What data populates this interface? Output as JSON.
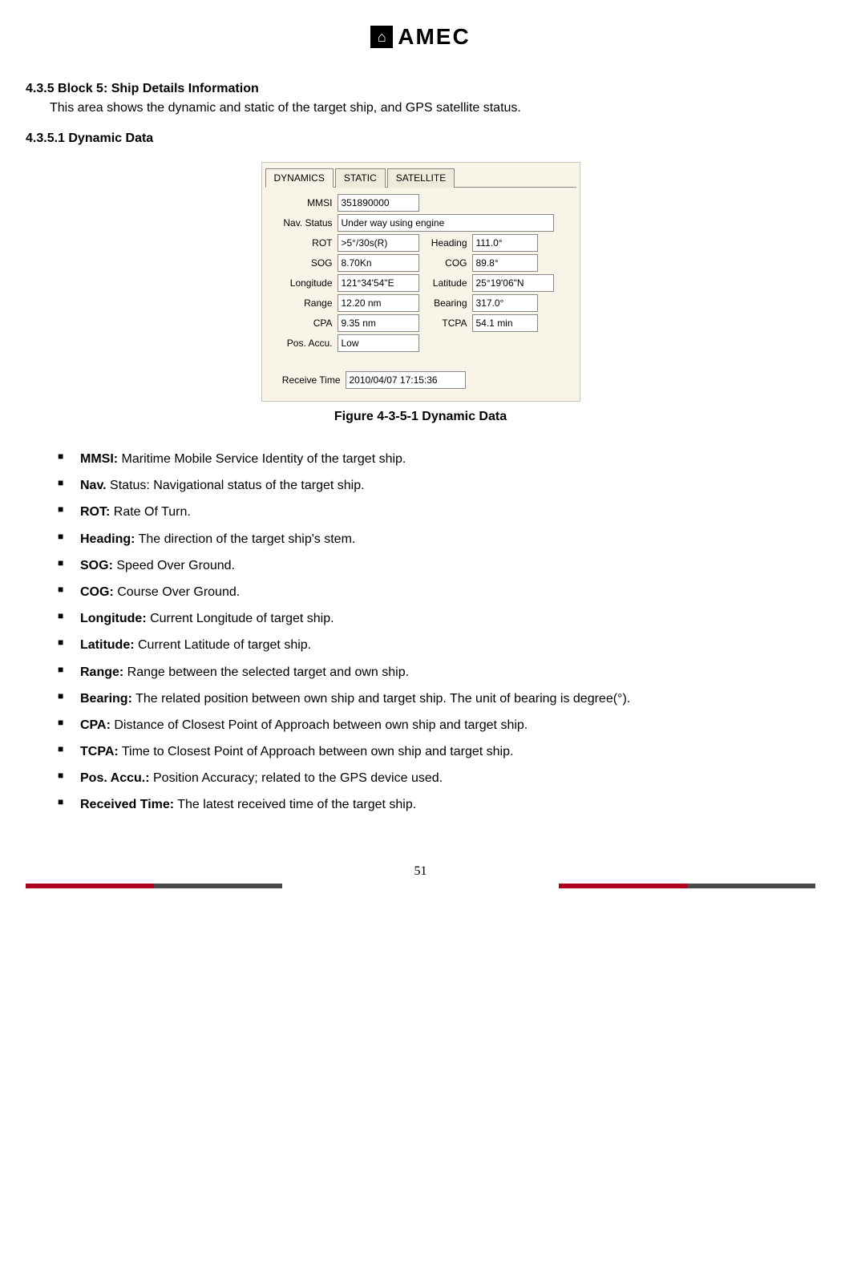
{
  "logo": {
    "text": "AMEC"
  },
  "section": {
    "h1": "4.3.5 Block 5: Ship Details Information",
    "intro": "This area shows the dynamic and static of the target ship, and GPS satellite status.",
    "h2": "4.3.5.1 Dynamic Data",
    "caption": "Figure 4-3-5-1 Dynamic Data"
  },
  "tabs": {
    "dynamics": "DYNAMICS",
    "static": "STATIC",
    "satellite": "SATELLITE"
  },
  "labels": {
    "mmsi": "MMSI",
    "nav": "Nav. Status",
    "rot": "ROT",
    "heading": "Heading",
    "sog": "SOG",
    "cog": "COG",
    "lon": "Longitude",
    "lat": "Latitude",
    "range": "Range",
    "bearing": "Bearing",
    "cpa": "CPA",
    "tcpa": "TCPA",
    "posaccu": "Pos. Accu.",
    "rtime": "Receive Time"
  },
  "values": {
    "mmsi": "351890000",
    "nav": "Under way using engine",
    "rot": ">5°/30s(R)",
    "heading": "111.0°",
    "sog": "8.70Kn",
    "cog": "89.8°",
    "lon": "121°34'54\"E",
    "lat": "25°19'06\"N",
    "range": "12.20 nm",
    "bearing": "317.0°",
    "cpa": "9.35 nm",
    "tcpa": "54.1 min",
    "posaccu": "Low",
    "rtime": "2010/04/07 17:15:36"
  },
  "defs": [
    {
      "term": "MMSI:",
      "desc": " Maritime Mobile Service Identity of the target ship."
    },
    {
      "term": "Nav.",
      "desc": " Status: Navigational status of the target ship."
    },
    {
      "term": "ROT:",
      "desc": " Rate Of Turn."
    },
    {
      "term": "Heading:",
      "desc": " The direction of the target ship's stem."
    },
    {
      "term": "SOG:",
      "desc": " Speed Over Ground."
    },
    {
      "term": "COG:",
      "desc": " Course Over Ground."
    },
    {
      "term": "Longitude:",
      "desc": " Current Longitude of target ship."
    },
    {
      "term": "Latitude:",
      "desc": " Current Latitude of target ship."
    },
    {
      "term": "Range:",
      "desc": " Range between the selected target and own ship."
    },
    {
      "term": "Bearing:",
      "desc": " The related position between own ship and target ship. The unit of bearing is degree(°)."
    },
    {
      "term": "CPA:",
      "desc": " Distance of Closest Point of Approach between own ship and target ship."
    },
    {
      "term": "TCPA:",
      "desc": " Time to Closest Point of Approach between own ship and target ship."
    },
    {
      "term": "Pos. Accu.:",
      "desc": " Position Accuracy; related to the GPS device used."
    },
    {
      "term": "Received Time:",
      "desc": " The latest received time of the target ship."
    }
  ],
  "pageNumber": "51"
}
